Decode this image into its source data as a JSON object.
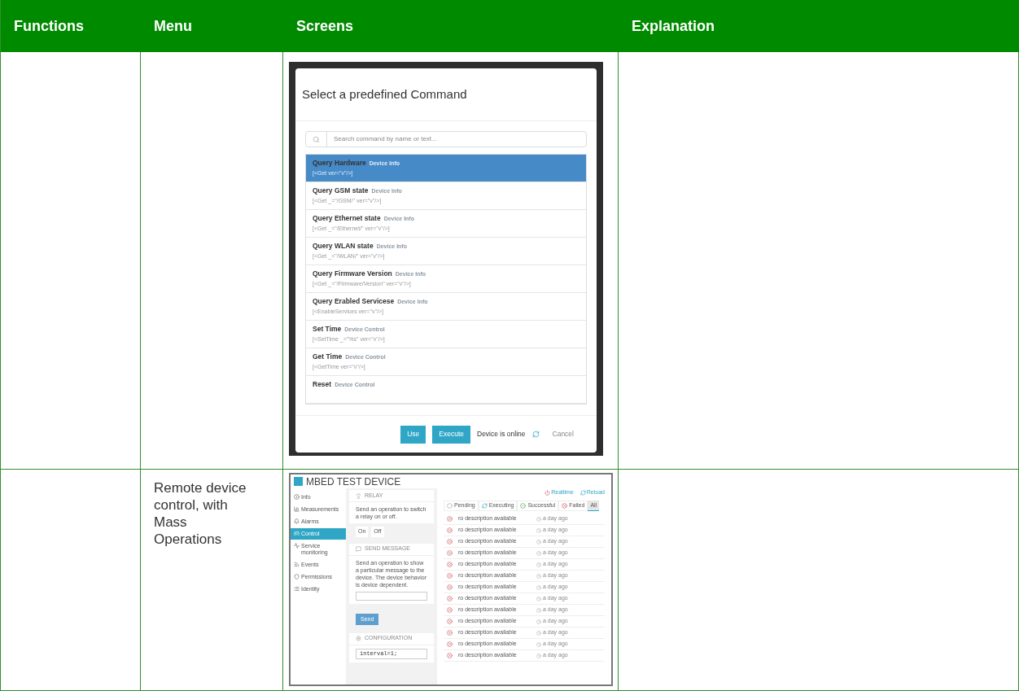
{
  "table": {
    "columns": [
      "Functions",
      "Menu",
      "Screens",
      "Explanation"
    ],
    "rows": [
      {
        "screen": {
          "kind": "command_dialog",
          "title": "Select a predefined Command",
          "search": {
            "placeholder": "Search command by name or text..."
          },
          "commands": [
            {
              "name": "Query Hardware",
              "category": "Device Info",
              "code": "[<Get ver=\"v\"/>]",
              "selected": true
            },
            {
              "name": "Query GSM state",
              "category": "Device Info",
              "code": "[<Get _=\"/GSM/\" ver=\"v\"/>]",
              "selected": false
            },
            {
              "name": "Query Ethernet state",
              "category": "Device Info",
              "code": "[<Get _=\"/Ethernet/\" ver=\"v\"/>]",
              "selected": false
            },
            {
              "name": "Query WLAN state",
              "category": "Device Info",
              "code": "[<Get _=\"/WLAN/\" ver=\"v\"/>]",
              "selected": false
            },
            {
              "name": "Query Firmware Version",
              "category": "Device Info",
              "code": "[<Get _=\"/Firmware/Version\" ver=\"v\"/>]",
              "selected": false
            },
            {
              "name": "Query Erabled Servicese",
              "category": "Device Info",
              "code": "[<EnableServices ver=\"v\"/>]",
              "selected": false
            },
            {
              "name": "Set Time",
              "category": "Device Control",
              "code": "[<SetTime _=\"%s\" ver=\"v\"/>]",
              "selected": false
            },
            {
              "name": "Get Time",
              "category": "Device Control",
              "code": "[<GetTime ver=\"v\"/>]",
              "selected": false
            },
            {
              "name": "Reset",
              "category": "Device Control",
              "selected": false
            }
          ],
          "buttons": [
            "Use",
            "Execute"
          ],
          "status": "Device is online",
          "cancel": "Cancel"
        }
      },
      {
        "menu": "Remote device control, with Mass Operations",
        "screen": {
          "kind": "device_page",
          "title": "MBED TEST DEVICE",
          "sidebar": [
            {
              "label": "Info",
              "selected": false
            },
            {
              "label": "Measurements",
              "selected": false
            },
            {
              "label": "Alarms",
              "selected": false
            },
            {
              "label": "Control",
              "selected": true
            },
            {
              "label": "Service monitoring",
              "selected": false
            },
            {
              "label": "Events",
              "selected": false
            },
            {
              "label": "Permissions",
              "selected": false
            },
            {
              "label": "Identity",
              "selected": false
            }
          ],
          "relay": {
            "title": "RELAY",
            "text": "Send an operation to switch a relay on or off.",
            "buttons": [
              "On",
              "Off"
            ]
          },
          "message": {
            "title": "SEND MESSAGE",
            "text": "Send an operation to show a particular message to the device. The device behavior is device dependent.",
            "button": "Send"
          },
          "configuration": {
            "title": "CONFIGURATION",
            "value": "interval=1;"
          },
          "actions": [
            "Realtime",
            "Reload"
          ],
          "tabs": [
            {
              "label": "Pending",
              "kind": "pending",
              "selected": false
            },
            {
              "label": "Executing",
              "kind": "executing",
              "selected": false
            },
            {
              "label": "Successful",
              "kind": "successful",
              "selected": false
            },
            {
              "label": "Failed",
              "kind": "failed",
              "selected": false
            },
            {
              "label": "All",
              "kind": "all",
              "selected": true
            }
          ],
          "operations": [
            {
              "kind": "failed",
              "text": "ro description available",
              "time": "a day ago"
            },
            {
              "kind": "failed",
              "text": "ro description available",
              "time": "a day ago"
            },
            {
              "kind": "failed",
              "text": "ro description available",
              "time": "a day ago"
            },
            {
              "kind": "failed",
              "text": "ro description available",
              "time": "a day ago"
            },
            {
              "kind": "failed",
              "text": "ro description available",
              "time": "a day ago"
            },
            {
              "kind": "failed",
              "text": "ro description available",
              "time": "a day ago"
            },
            {
              "kind": "failed",
              "text": "ro description available",
              "time": "a day ago"
            },
            {
              "kind": "failed",
              "text": "ro description available",
              "time": "a day ago"
            },
            {
              "kind": "failed",
              "text": "ro description available",
              "time": "a day ago"
            },
            {
              "kind": "failed",
              "text": "ro description available",
              "time": "a day ago"
            },
            {
              "kind": "failed",
              "text": "ro description available",
              "time": "a day ago"
            },
            {
              "kind": "failed",
              "text": "ro description available",
              "time": "a day ago"
            },
            {
              "kind": "failed",
              "text": "ro description available",
              "time": "a day ago"
            }
          ]
        }
      }
    ]
  }
}
